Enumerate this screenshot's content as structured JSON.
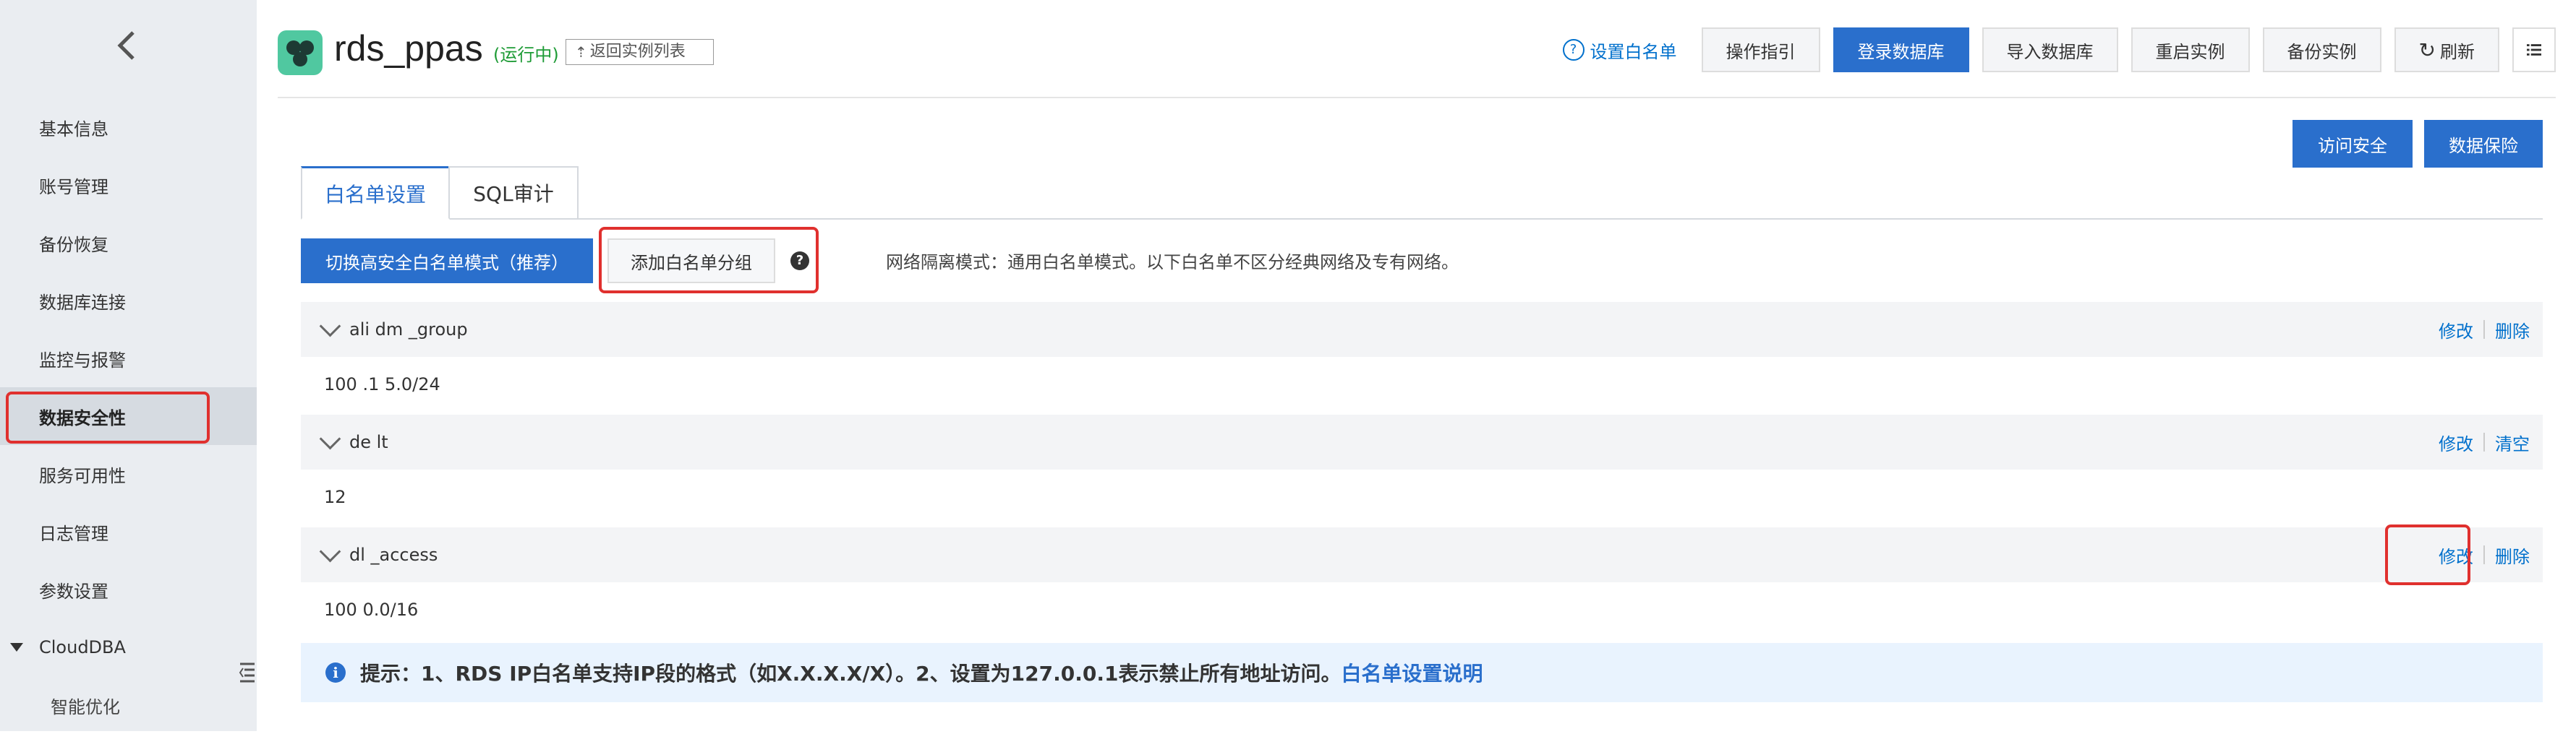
{
  "colors": {
    "accent": "#2a6fcc",
    "link": "#0070cc",
    "status_running": "#1e9b36",
    "highlight": "#e0302e",
    "tip_bg": "#e9f3fe"
  },
  "sidebar": {
    "back_icon": "chevron-left-icon",
    "items": [
      {
        "label": "基本信息"
      },
      {
        "label": "账号管理"
      },
      {
        "label": "备份恢复"
      },
      {
        "label": "数据库连接"
      },
      {
        "label": "监控与报警"
      },
      {
        "label": "数据安全性",
        "active": true
      },
      {
        "label": "服务可用性"
      },
      {
        "label": "日志管理"
      },
      {
        "label": "参数设置"
      },
      {
        "label": "CloudDBA",
        "group": true
      },
      {
        "label": "智能优化",
        "sub": true
      }
    ]
  },
  "header": {
    "instance_name": "rds_ppas",
    "status": "(运行中)",
    "back_to_list": "返回实例列表",
    "whitelist_link": "设置白名单",
    "buttons": {
      "guide": "操作指引",
      "login_db": "登录数据库",
      "import_db": "导入数据库",
      "restart": "重启实例",
      "backup": "备份实例",
      "refresh": "刷新"
    }
  },
  "right_buttons": {
    "access_security": "访问安全",
    "data_protection": "数据保险"
  },
  "tabs": [
    {
      "label": "白名单设置",
      "active": true
    },
    {
      "label": "SQL审计"
    }
  ],
  "toolbar": {
    "switch_mode": "切换高安全白名单模式（推荐）",
    "add_group": "添加白名单分组",
    "help": "?",
    "network_mode": "网络隔离模式：通用白名单模式。以下白名单不区分经典网络及专有网络。"
  },
  "groups": [
    {
      "name": "ali dm _group",
      "ips": "100 .1 5.0/24",
      "actions": [
        "修改",
        "删除"
      ]
    },
    {
      "name": "de lt",
      "ips": "12",
      "actions": [
        "修改",
        "清空"
      ]
    },
    {
      "name": "dl _access",
      "ips": "100 0.0/16",
      "actions": [
        "修改",
        "删除"
      ]
    }
  ],
  "tip": {
    "text": "提示：1、RDS IP白名单支持IP段的格式（如X.X.X.X/X）。2、设置为127.0.0.1表示禁止所有地址访问。",
    "link": "白名单设置说明"
  }
}
